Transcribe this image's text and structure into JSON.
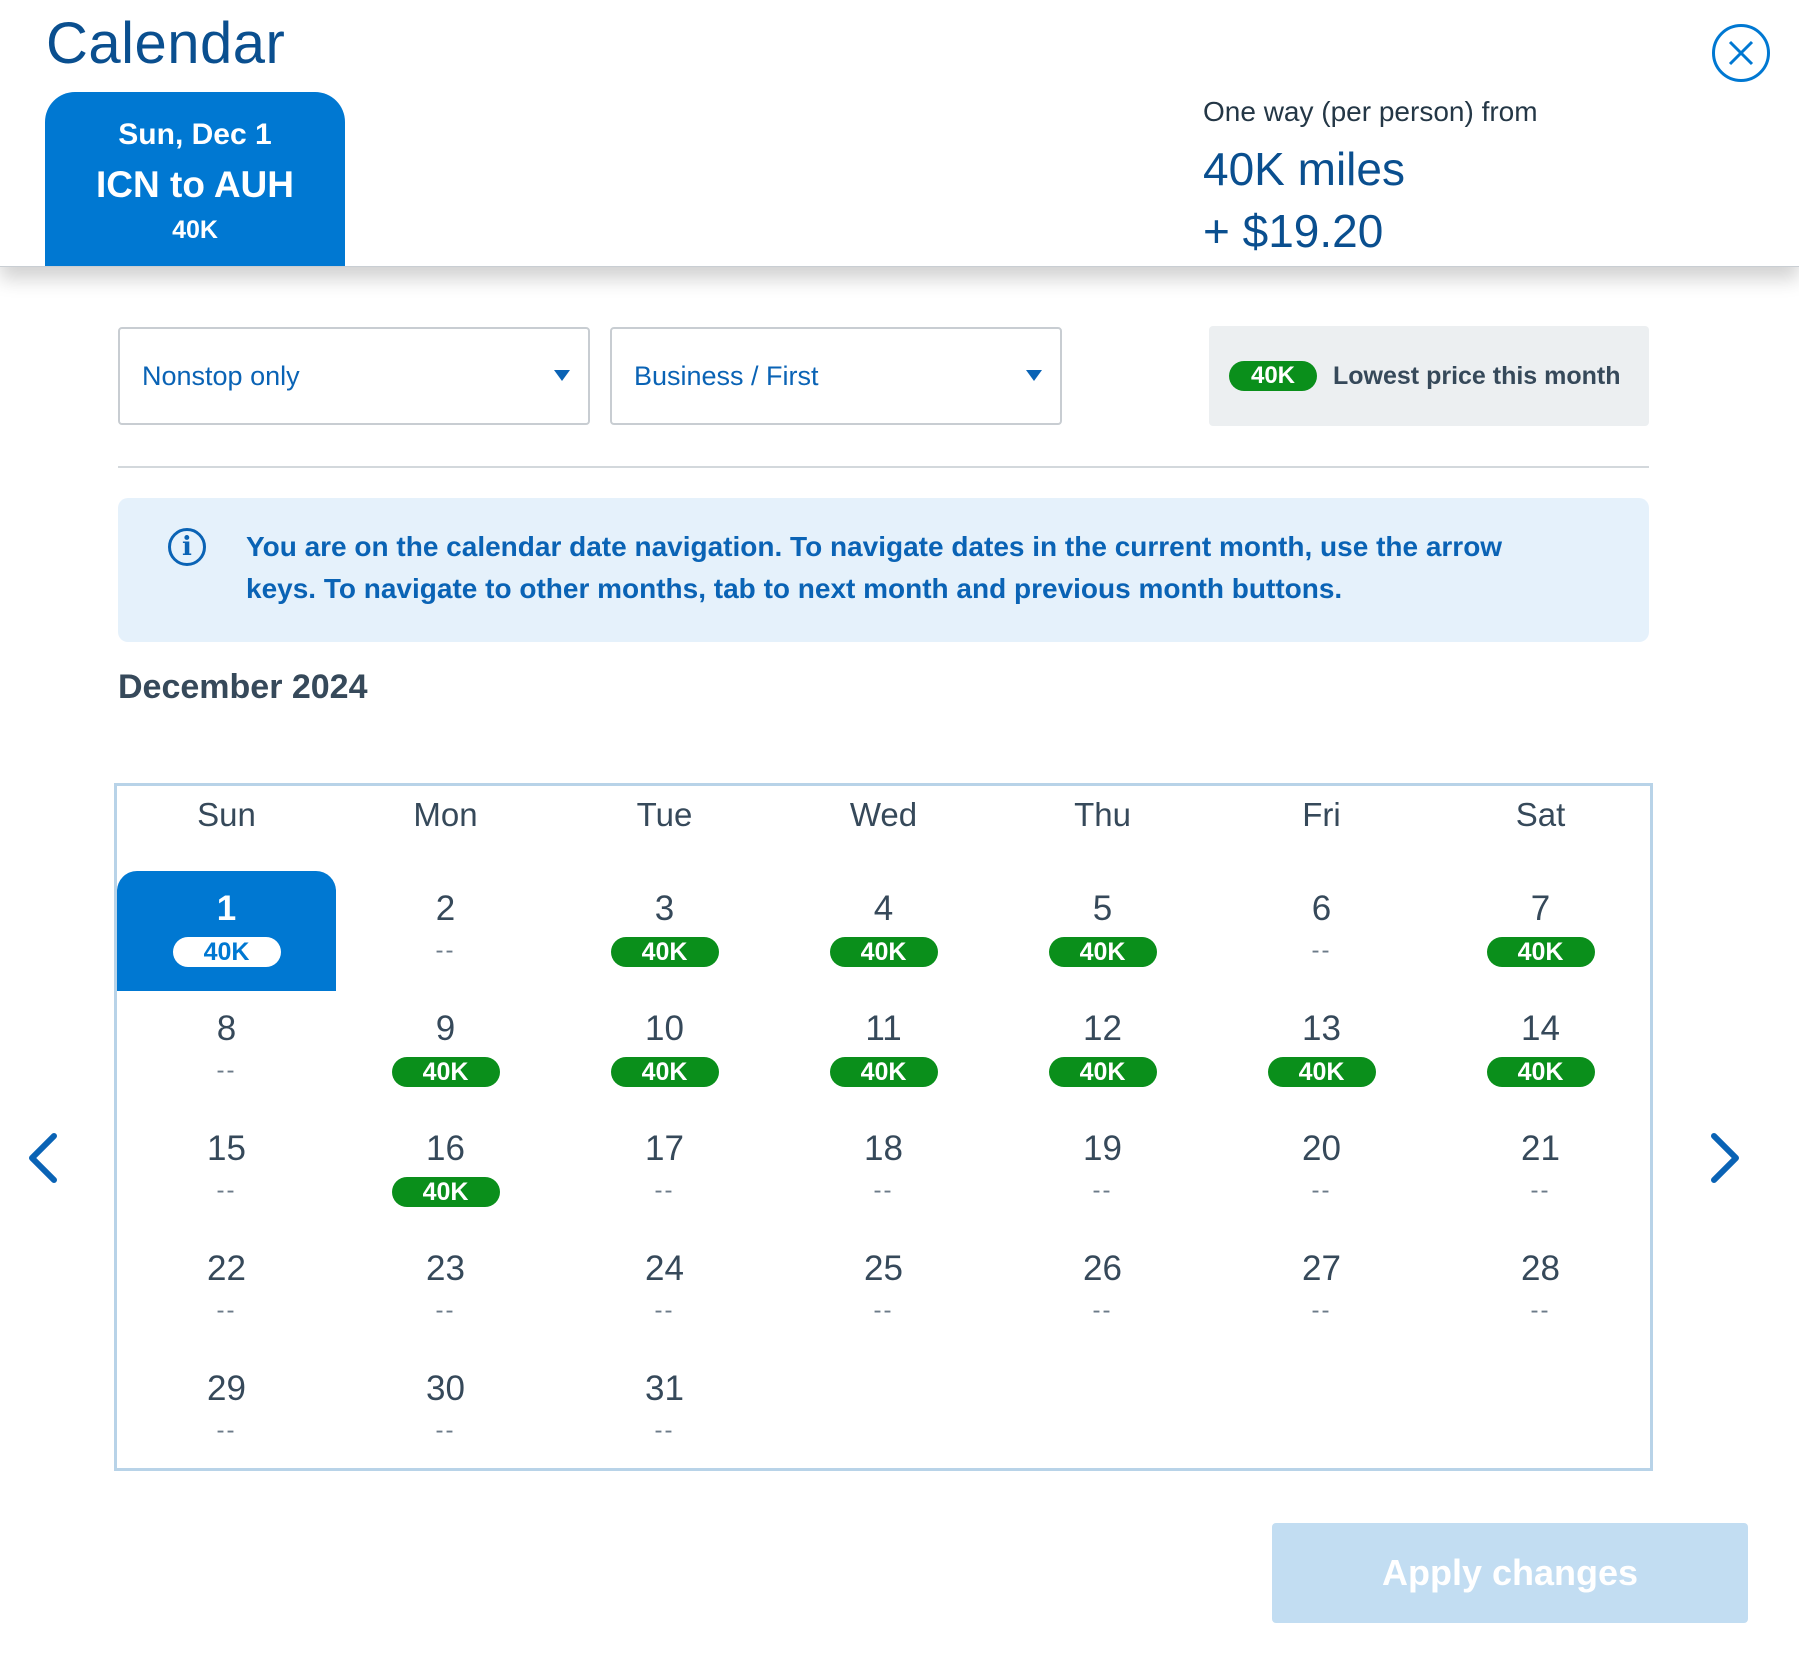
{
  "page": {
    "title": "Calendar"
  },
  "trip": {
    "date": "Sun, Dec 1",
    "route": "ICN to AUH",
    "price": "40K"
  },
  "fare": {
    "label": "One way (per person) from",
    "miles": "40K miles",
    "tax": "+ $19.20"
  },
  "filters": {
    "stops": "Nonstop only",
    "cabin": "Business / First"
  },
  "legend": {
    "badge": "40K",
    "text": "Lowest price this month"
  },
  "info": {
    "text": "You are on the calendar date navigation. To navigate dates in the current month, use the arrow keys. To navigate to other months, tab to next month and previous month buttons."
  },
  "calendar": {
    "month": "December 2024",
    "weekdays": [
      "Sun",
      "Mon",
      "Tue",
      "Wed",
      "Thu",
      "Fri",
      "Sat"
    ],
    "days": [
      {
        "day": "1",
        "price": "40K",
        "badge": true,
        "selected": true
      },
      {
        "day": "2",
        "price": "--",
        "badge": false
      },
      {
        "day": "3",
        "price": "40K",
        "badge": true
      },
      {
        "day": "4",
        "price": "40K",
        "badge": true
      },
      {
        "day": "5",
        "price": "40K",
        "badge": true
      },
      {
        "day": "6",
        "price": "--",
        "badge": false
      },
      {
        "day": "7",
        "price": "40K",
        "badge": true
      },
      {
        "day": "8",
        "price": "--",
        "badge": false
      },
      {
        "day": "9",
        "price": "40K",
        "badge": true
      },
      {
        "day": "10",
        "price": "40K",
        "badge": true
      },
      {
        "day": "11",
        "price": "40K",
        "badge": true
      },
      {
        "day": "12",
        "price": "40K",
        "badge": true
      },
      {
        "day": "13",
        "price": "40K",
        "badge": true
      },
      {
        "day": "14",
        "price": "40K",
        "badge": true
      },
      {
        "day": "15",
        "price": "--",
        "badge": false
      },
      {
        "day": "16",
        "price": "40K",
        "badge": true
      },
      {
        "day": "17",
        "price": "--",
        "badge": false
      },
      {
        "day": "18",
        "price": "--",
        "badge": false
      },
      {
        "day": "19",
        "price": "--",
        "badge": false
      },
      {
        "day": "20",
        "price": "--",
        "badge": false
      },
      {
        "day": "21",
        "price": "--",
        "badge": false
      },
      {
        "day": "22",
        "price": "--",
        "badge": false
      },
      {
        "day": "23",
        "price": "--",
        "badge": false
      },
      {
        "day": "24",
        "price": "--",
        "badge": false
      },
      {
        "day": "25",
        "price": "--",
        "badge": false
      },
      {
        "day": "26",
        "price": "--",
        "badge": false
      },
      {
        "day": "27",
        "price": "--",
        "badge": false
      },
      {
        "day": "28",
        "price": "--",
        "badge": false
      },
      {
        "day": "29",
        "price": "--",
        "badge": false
      },
      {
        "day": "30",
        "price": "--",
        "badge": false
      },
      {
        "day": "31",
        "price": "--",
        "badge": false
      }
    ]
  },
  "actions": {
    "apply": "Apply changes"
  },
  "colors": {
    "brand": "#0078d2",
    "navy": "#0a4f8f",
    "price_badge": "#0a8f1b",
    "info_bg": "#e5f1fb"
  },
  "icons": {
    "close": "close-icon",
    "info": "info-icon",
    "prev": "chevron-left-icon",
    "next": "chevron-right-icon",
    "caret": "caret-down-icon"
  }
}
